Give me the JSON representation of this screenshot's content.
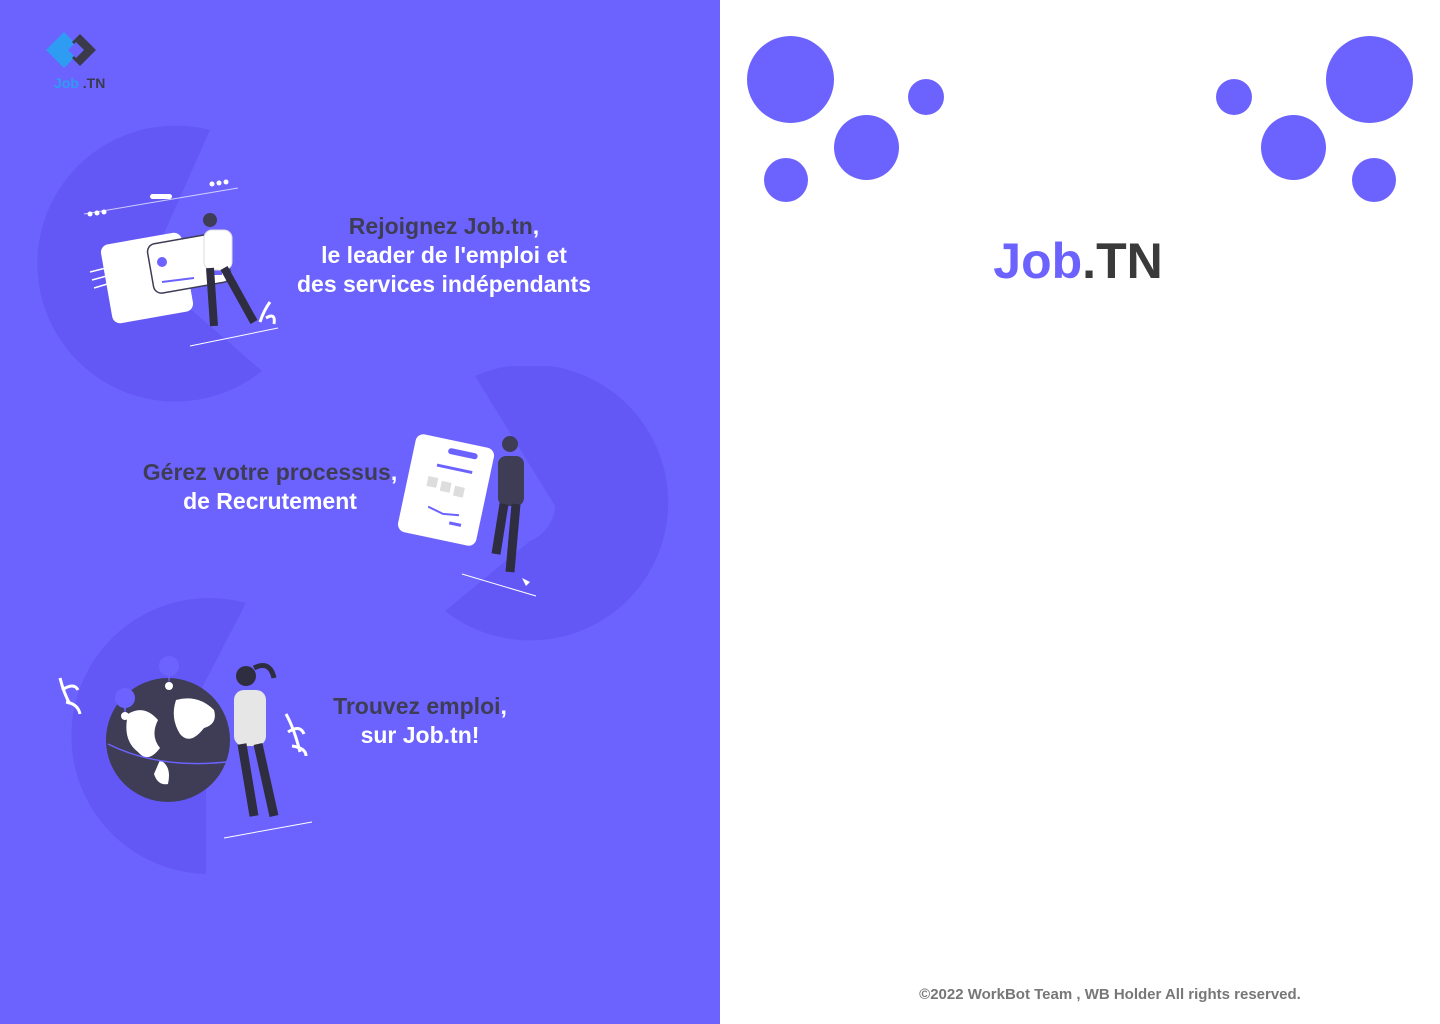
{
  "logo": {
    "job": "Job",
    "tn": ".TN"
  },
  "features": [
    {
      "line1_dark": "Rejoignez Job.tn",
      "line1_rest": ",",
      "line2": "le leader de l'emploi et",
      "line3": "des services indépendants"
    },
    {
      "line1_dark": "Gérez votre processus",
      "line1_rest": ",",
      "line2": "de Recrutement"
    },
    {
      "line1_dark": "Trouvez emploi",
      "line1_rest": ",",
      "line2": "sur Job.tn!"
    }
  ],
  "brand": {
    "job": "Job",
    "tn": ".TN"
  },
  "footer": {
    "text": "©2022 WorkBot Team , WB Holder All rights reserved."
  },
  "colors": {
    "primary": "#6c63ff",
    "dark": "#3f3d56",
    "logo_blue": "#2f9cf4",
    "footer_gray": "#777777"
  },
  "icons": {
    "logo": "job-tn-logo-icon",
    "illustration_1": "credit-card-illustration",
    "illustration_2": "form-document-illustration",
    "illustration_3": "world-map-illustration"
  }
}
